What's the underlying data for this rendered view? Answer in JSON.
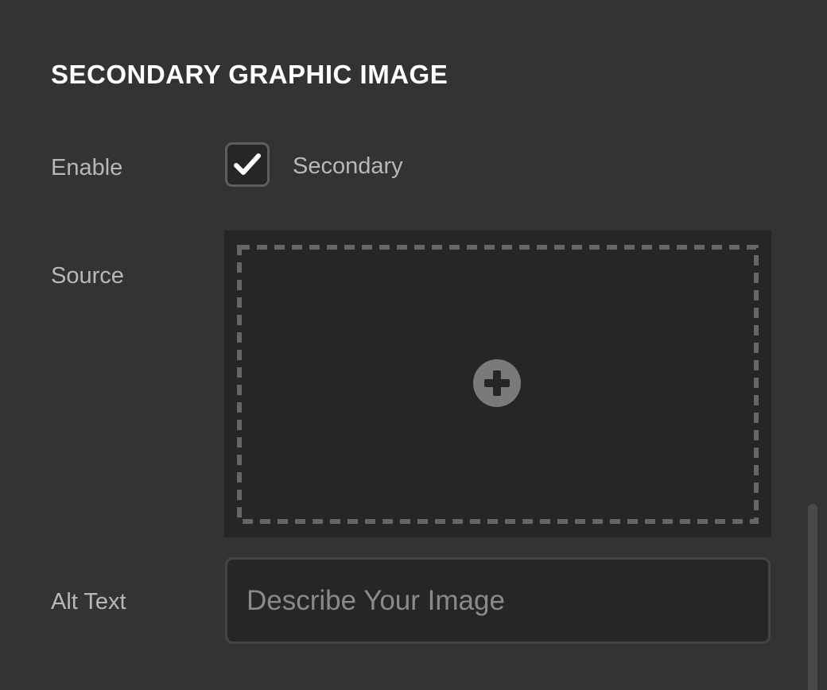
{
  "section": {
    "title": "SECONDARY GRAPHIC IMAGE"
  },
  "fields": {
    "enable": {
      "label": "Enable",
      "checkbox_label": "Secondary",
      "checked": true
    },
    "source": {
      "label": "Source",
      "add_icon": "plus-circle-icon"
    },
    "alt_text": {
      "label": "Alt Text",
      "placeholder": "Describe Your Image",
      "value": ""
    }
  },
  "colors": {
    "background": "#333333",
    "field_background": "#262626",
    "label_text": "#b8b8b8",
    "title_text": "#ffffff",
    "dashed_border": "#666666",
    "icon": "#7a7a7a"
  }
}
